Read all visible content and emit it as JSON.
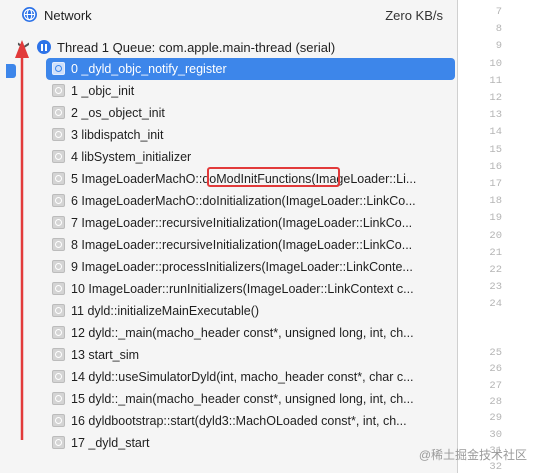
{
  "network": {
    "icon": "globe-icon",
    "label": "Network",
    "speed": "Zero KB/s"
  },
  "thread": {
    "label": "Thread 1 Queue: com.apple.main-thread (serial)"
  },
  "frames": [
    "0 _dyld_objc_notify_register",
    "1 _objc_init",
    "2 _os_object_init",
    "3 libdispatch_init",
    "4 libSystem_initializer",
    "5 ImageLoaderMachO::doModInitFunctions(ImageLoader::Li...",
    "6 ImageLoaderMachO::doInitialization(ImageLoader::LinkCo...",
    "7 ImageLoader::recursiveInitialization(ImageLoader::LinkCo...",
    "8 ImageLoader::recursiveInitialization(ImageLoader::LinkCo...",
    "9 ImageLoader::processInitializers(ImageLoader::LinkConte...",
    "10 ImageLoader::runInitializers(ImageLoader::LinkContext c...",
    "11 dyld::initializeMainExecutable()",
    "12 dyld::_main(macho_header const*, unsigned long, int, ch...",
    "13 start_sim",
    "14 dyld::useSimulatorDyld(int, macho_header const*, char c...",
    "15 dyld::_main(macho_header const*, unsigned long, int, ch...",
    "16 dyldbootstrap::start(dyld3::MachOLoaded const*, int, ch...",
    "17 _dyld_start"
  ],
  "selected_frame_index": 0,
  "line_numbers_top": [
    "7",
    "8",
    "9",
    "10",
    "11",
    "12",
    "13",
    "14",
    "15",
    "16",
    "17",
    "18",
    "19",
    "20",
    "21",
    "22",
    "23",
    "24"
  ],
  "line_numbers_bottom": [
    "25",
    "26",
    "27",
    "28",
    "29",
    "30",
    "31",
    "32"
  ],
  "watermark": "@稀土掘金技术社区",
  "colors": {
    "selection": "#3d86ea",
    "annotation": "#e23a3a",
    "accent": "#2d73e8"
  }
}
